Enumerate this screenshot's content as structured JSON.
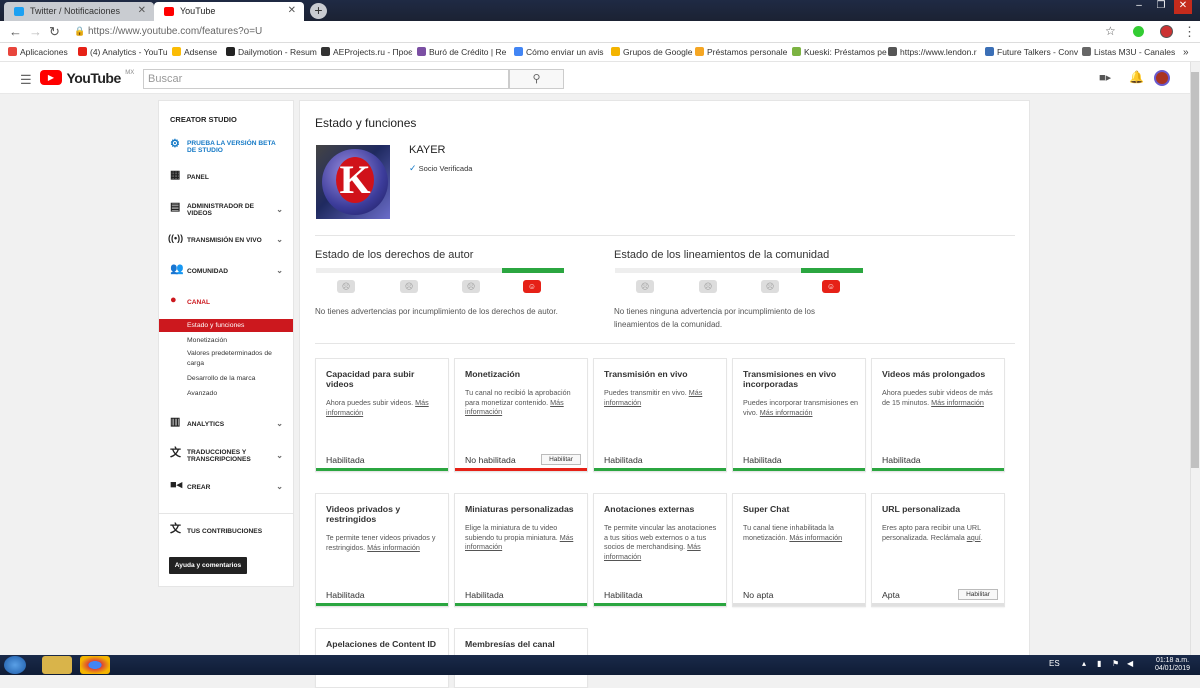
{
  "browser": {
    "tabs": [
      {
        "title": "Twitter / Notificaciones",
        "icon": "twitter-icon",
        "color": "#1da1f2"
      },
      {
        "title": "YouTube",
        "icon": "youtube-icon",
        "color": "#ff0000"
      }
    ],
    "url": "https://www.youtube.com/features?o=U",
    "bookmarks": [
      {
        "label": "Aplicaciones",
        "color": "#e8453c"
      },
      {
        "label": "(4) Analytics - YouTu",
        "color": "#e62117"
      },
      {
        "label": "Adsense",
        "color": "#fbbc05"
      },
      {
        "label": "Dailymotion - Resum",
        "color": "#222222"
      },
      {
        "label": "AEProjects.ru - Проє",
        "color": "#333333"
      },
      {
        "label": "Buró de Crédito | Re",
        "color": "#7b4fa3"
      },
      {
        "label": "Cómo enviar un avis",
        "color": "#4285f4"
      },
      {
        "label": "Grupos de Google",
        "color": "#f4b400"
      },
      {
        "label": "Préstamos personale",
        "color": "#f5a623"
      },
      {
        "label": "Kueski: Préstamos pe",
        "color": "#7cb342"
      },
      {
        "label": "https://www.lendon.r",
        "color": "#555555"
      },
      {
        "label": "Future Talkers - Conv",
        "color": "#3b6fb6"
      },
      {
        "label": "Listas M3U - Canales",
        "color": "#666666"
      }
    ]
  },
  "header": {
    "logo_text": "YouTube",
    "logo_region": "MX",
    "search_placeholder": "Buscar"
  },
  "sidebar": {
    "title": "CREATOR STUDIO",
    "items": [
      {
        "label": "PRUEBA LA VERSIÓN BETA DE STUDIO",
        "icon": "gear-icon"
      },
      {
        "label": "PANEL",
        "icon": "dashboard-icon"
      },
      {
        "label": "ADMINISTRADOR DE VIDEOS",
        "icon": "video-manager-icon"
      },
      {
        "label": "TRANSMISIÓN EN VIVO",
        "icon": "live-icon"
      },
      {
        "label": "COMUNIDAD",
        "icon": "community-icon"
      },
      {
        "label": "CANAL",
        "icon": "channel-icon"
      },
      {
        "label": "ANALYTICS",
        "icon": "analytics-icon"
      },
      {
        "label": "TRADUCCIONES Y TRANSCRIPCIONES",
        "icon": "translate-icon"
      },
      {
        "label": "CREAR",
        "icon": "create-icon"
      },
      {
        "label": "TUS CONTRIBUCIONES",
        "icon": "contributions-icon"
      }
    ],
    "canal_subitems": [
      "Estado y funciones",
      "Monetización",
      "Valores predeterminados de carga",
      "Desarrollo de la marca",
      "Avanzado"
    ],
    "help_button": "Ayuda y comentarios"
  },
  "main": {
    "title": "Estado y funciones",
    "channel_name": "KAYER",
    "channel_status": "Socio Verificada",
    "copyright": {
      "title": "Estado de los derechos de autor",
      "message": "No tienes advertencias por incumplimiento de los derechos de autor."
    },
    "community": {
      "title": "Estado de los lineamientos de la comunidad",
      "message": "No tienes ninguna advertencia por incumplimiento de los lineamientos de la comunidad."
    },
    "cards": [
      {
        "title": "Capacidad para subir videos",
        "desc": "Ahora puedes subir videos.",
        "link": "Más información",
        "status": "Habilitada",
        "state": "ok"
      },
      {
        "title": "Monetización",
        "desc": "Tu canal no recibió la aprobación para monetizar contenido.",
        "link": "Más información",
        "status": "No habilitada",
        "state": "bad",
        "button": "Habilitar"
      },
      {
        "title": "Transmisión en vivo",
        "desc": "Puedes transmitir en vivo.",
        "link": "Más información",
        "status": "Habilitada",
        "state": "ok"
      },
      {
        "title": "Transmisiones en vivo incorporadas",
        "desc": "Puedes incorporar transmisiones en vivo.",
        "link": "Más información",
        "status": "Habilitada",
        "state": "ok"
      },
      {
        "title": "Videos más prolongados",
        "desc": "Ahora puedes subir videos de más de 15 minutos.",
        "link": "Más información",
        "status": "Habilitada",
        "state": "ok"
      },
      {
        "title": "Videos privados y restringidos",
        "desc": "Te permite tener videos privados y restringidos.",
        "link": "Más información",
        "status": "Habilitada",
        "state": "ok"
      },
      {
        "title": "Miniaturas personalizadas",
        "desc": "Elige la miniatura de tu video subiendo tu propia miniatura.",
        "link": "Más información",
        "status": "Habilitada",
        "state": "ok"
      },
      {
        "title": "Anotaciones externas",
        "desc": "Te permite vincular las anotaciones a tus sitios web externos o a tus socios de merchandising.",
        "link": "Más información",
        "status": "Habilitada",
        "state": "ok"
      },
      {
        "title": "Super Chat",
        "desc": "Tu canal tiene inhabilitada la monetización.",
        "link": "Más información",
        "status": "No apta",
        "state": "none"
      },
      {
        "title": "URL personalizada",
        "desc": "Eres apto para recibir una URL personalizada. Reclámala",
        "link": "aquí",
        "status": "Apta",
        "state": "none",
        "button": "Habilitar"
      },
      {
        "title": "Apelaciones de Content ID",
        "desc": "",
        "link": "",
        "status": "",
        "state": "none"
      },
      {
        "title": "Membresías del canal",
        "desc": "",
        "link": "",
        "status": "",
        "state": "none"
      }
    ]
  },
  "taskbar": {
    "lang": "ES",
    "time": "01:18 a.m.",
    "date": "04/01/2019"
  },
  "colors": {
    "yt_red": "#cc181e",
    "ok_green": "#2ba640",
    "bad_red": "#e62117"
  }
}
